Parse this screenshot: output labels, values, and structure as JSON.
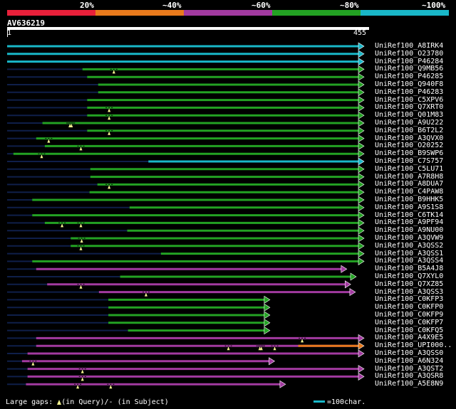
{
  "scale": {
    "labels": [
      "20%",
      "~40%",
      "~60%",
      "~80%",
      "~100%"
    ],
    "colors": [
      "#e8203a",
      "#e87a1c",
      "#a23aa0",
      "#23a223",
      "#19b7c8"
    ]
  },
  "query": {
    "name": "AV636219",
    "start_label": "1",
    "end_label": "455",
    "length": 455
  },
  "legend": {
    "gaps_prefix": "Large gaps:",
    "gaps_query": "(in Query)/",
    "gaps_dash": "-",
    "gaps_subject": "(in Subject)",
    "scale_text": "=100char."
  },
  "colors": {
    "cyan": "#19b7c8",
    "green": "#23a223",
    "purple": "#a23aa0",
    "orange": "#e87a1c",
    "dark": "#0f1f4a",
    "gap_marker": "#f5f590"
  },
  "chart_data": {
    "type": "alignment",
    "query_length": 455,
    "hits": [
      {
        "name": "UniRef100_A8IRK4",
        "start": 1,
        "end": 455,
        "color": "cyan",
        "gaps": []
      },
      {
        "name": "UniRef100_O23780",
        "start": 1,
        "end": 455,
        "color": "cyan",
        "gaps": []
      },
      {
        "name": "UniRef100_P46284",
        "start": 1,
        "end": 455,
        "color": "cyan",
        "gaps": []
      },
      {
        "name": "UniRef100_Q9MB56",
        "start": 97,
        "end": 455,
        "color": "green",
        "gaps": [
          137
        ]
      },
      {
        "name": "UniRef100_P46285",
        "start": 103,
        "end": 455,
        "color": "green",
        "gaps": []
      },
      {
        "name": "UniRef100_Q940F8",
        "start": 117,
        "end": 455,
        "color": "green",
        "gaps": []
      },
      {
        "name": "UniRef100_P46283",
        "start": 117,
        "end": 455,
        "color": "green",
        "gaps": []
      },
      {
        "name": "UniRef100_C5XPV6",
        "start": 103,
        "end": 455,
        "color": "green",
        "gaps": []
      },
      {
        "name": "UniRef100_Q7XRT0",
        "start": 103,
        "end": 455,
        "color": "green",
        "gaps": [
          131
        ]
      },
      {
        "name": "UniRef100_Q01M83",
        "start": 103,
        "end": 455,
        "color": "green",
        "gaps": [
          131
        ]
      },
      {
        "name": "UniRef100_A9U222",
        "start": 46,
        "end": 455,
        "color": "green",
        "gaps": [
          81,
          83
        ]
      },
      {
        "name": "UniRef100_B6T2L2",
        "start": 103,
        "end": 455,
        "color": "green",
        "gaps": [
          131
        ]
      },
      {
        "name": "UniRef100_A3QVX0",
        "start": 38,
        "end": 455,
        "color": "green",
        "gaps": [
          54
        ]
      },
      {
        "name": "UniRef100_O20252",
        "start": 49,
        "end": 455,
        "color": "green",
        "gaps": [
          95
        ]
      },
      {
        "name": "UniRef100_B9SWP6",
        "start": 9,
        "end": 455,
        "color": "green",
        "gaps": [
          45
        ]
      },
      {
        "name": "UniRef100_C7S757",
        "start": 181,
        "end": 455,
        "color": "cyan",
        "gaps": []
      },
      {
        "name": "UniRef100_C5LU71",
        "start": 107,
        "end": 455,
        "color": "green",
        "gaps": []
      },
      {
        "name": "UniRef100_A7R8H8",
        "start": 107,
        "end": 455,
        "color": "green",
        "gaps": []
      },
      {
        "name": "UniRef100_A8DUA7",
        "start": 116,
        "end": 455,
        "color": "green",
        "gaps": [
          131
        ]
      },
      {
        "name": "UniRef100_C4PAW8",
        "start": 106,
        "end": 455,
        "color": "green",
        "gaps": []
      },
      {
        "name": "UniRef100_B9HHK5",
        "start": 33,
        "end": 455,
        "color": "green",
        "gaps": []
      },
      {
        "name": "UniRef100_A9S1S8",
        "start": 157,
        "end": 455,
        "color": "green",
        "gaps": []
      },
      {
        "name": "UniRef100_C6TK14",
        "start": 33,
        "end": 455,
        "color": "green",
        "gaps": []
      },
      {
        "name": "UniRef100_A9PF94",
        "start": 49,
        "end": 455,
        "color": "green",
        "gaps": [
          71,
          95
        ]
      },
      {
        "name": "UniRef100_A9NU00",
        "start": 154,
        "end": 455,
        "color": "green",
        "gaps": []
      },
      {
        "name": "UniRef100_A3QVW9",
        "start": 82,
        "end": 455,
        "color": "green",
        "gaps": [
          96
        ]
      },
      {
        "name": "UniRef100_A3QSS2",
        "start": 82,
        "end": 455,
        "color": "green",
        "gaps": [
          95
        ]
      },
      {
        "name": "UniRef100_A3QSS1",
        "start": 197,
        "end": 455,
        "color": "green",
        "gaps": []
      },
      {
        "name": "UniRef100_A3QSS4",
        "start": 33,
        "end": 455,
        "color": "green",
        "gaps": []
      },
      {
        "name": "UniRef100_B5A4J8",
        "start": 38,
        "end": 433,
        "color": "purple",
        "gaps": []
      },
      {
        "name": "UniRef100_Q7XYL0",
        "start": 145,
        "end": 445,
        "color": "green",
        "gaps": []
      },
      {
        "name": "UniRef100_Q7XZ85",
        "start": 52,
        "end": 438,
        "color": "purple",
        "gaps": [
          95
        ]
      },
      {
        "name": "UniRef100_A3QSS3",
        "start": 118,
        "end": 444,
        "color": "purple",
        "gaps": [
          178
        ]
      },
      {
        "name": "UniRef100_C0KFP3",
        "start": 130,
        "end": 335,
        "color": "green",
        "gaps": []
      },
      {
        "name": "UniRef100_C0KFP0",
        "start": 130,
        "end": 335,
        "color": "green",
        "gaps": []
      },
      {
        "name": "UniRef100_C0KFP9",
        "start": 130,
        "end": 335,
        "color": "green",
        "gaps": []
      },
      {
        "name": "UniRef100_C0KFP7",
        "start": 130,
        "end": 335,
        "color": "green",
        "gaps": []
      },
      {
        "name": "UniRef100_C0KFQ5",
        "start": 155,
        "end": 335,
        "color": "green",
        "gaps": []
      },
      {
        "name": "UniRef100_A4X9E5",
        "start": 38,
        "end": 455,
        "color": "purple",
        "gaps": [
          377
        ]
      },
      {
        "name": "UniRef100_UPI000..",
        "start": 38,
        "end": 455,
        "color": "purple",
        "tail": {
          "start": 372,
          "end": 455,
          "color": "orange"
        },
        "gaps": [
          283,
          323,
          325,
          342
        ]
      },
      {
        "name": "UniRef100_A3QSS0",
        "start": 27,
        "end": 455,
        "color": "purple",
        "gaps": []
      },
      {
        "name": "UniRef100_A6N324",
        "start": 20,
        "end": 341,
        "color": "purple",
        "gaps": [
          34
        ]
      },
      {
        "name": "UniRef100_A3QST2",
        "start": 27,
        "end": 455,
        "color": "purple",
        "gaps": [
          97
        ]
      },
      {
        "name": "UniRef100_A3QSR8",
        "start": 27,
        "end": 455,
        "color": "purple",
        "gaps": [
          97
        ]
      },
      {
        "name": "UniRef100_A5E8N9",
        "start": 25,
        "end": 355,
        "color": "purple",
        "gaps": [
          91,
          133
        ]
      }
    ]
  }
}
